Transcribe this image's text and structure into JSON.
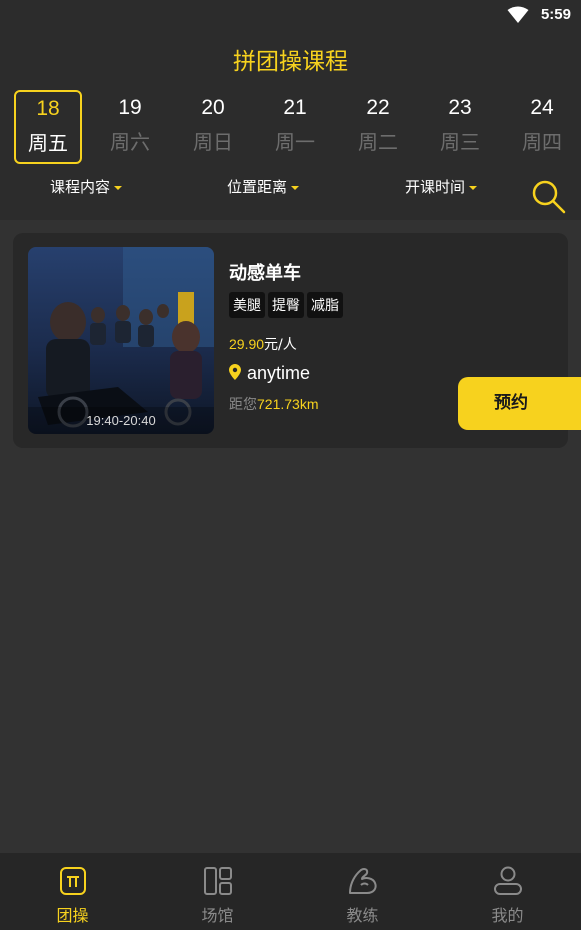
{
  "status_bar": {
    "time": "5:59"
  },
  "page": {
    "title": "拼团操课程"
  },
  "dates": [
    {
      "num": "18",
      "day": "周五",
      "active": true
    },
    {
      "num": "19",
      "day": "周六",
      "active": false
    },
    {
      "num": "20",
      "day": "周日",
      "active": false
    },
    {
      "num": "21",
      "day": "周一",
      "active": false
    },
    {
      "num": "22",
      "day": "周二",
      "active": false
    },
    {
      "num": "23",
      "day": "周三",
      "active": false
    },
    {
      "num": "24",
      "day": "周四",
      "active": false
    }
  ],
  "filters": {
    "course_content": "课程内容",
    "location_distance": "位置距离",
    "start_time": "开课时间"
  },
  "course": {
    "name": "动感单车",
    "tags": [
      "美腿",
      "提臀",
      "减脂"
    ],
    "price_amount": "29.90",
    "price_unit": "元/人",
    "location": "anytime",
    "distance_prefix": "距您",
    "distance_value": "721.73km",
    "time": "19:40-20:40",
    "book_label": "预约"
  },
  "tabs": [
    {
      "label": "团操",
      "icon": "group-class-icon",
      "active": true
    },
    {
      "label": "场馆",
      "icon": "venue-icon",
      "active": false
    },
    {
      "label": "教练",
      "icon": "coach-icon",
      "active": false
    },
    {
      "label": "我的",
      "icon": "profile-icon",
      "active": false
    }
  ],
  "colors": {
    "accent": "#f7d21e",
    "background": "#323232",
    "card": "#282828",
    "header": "#2c2c2c"
  }
}
